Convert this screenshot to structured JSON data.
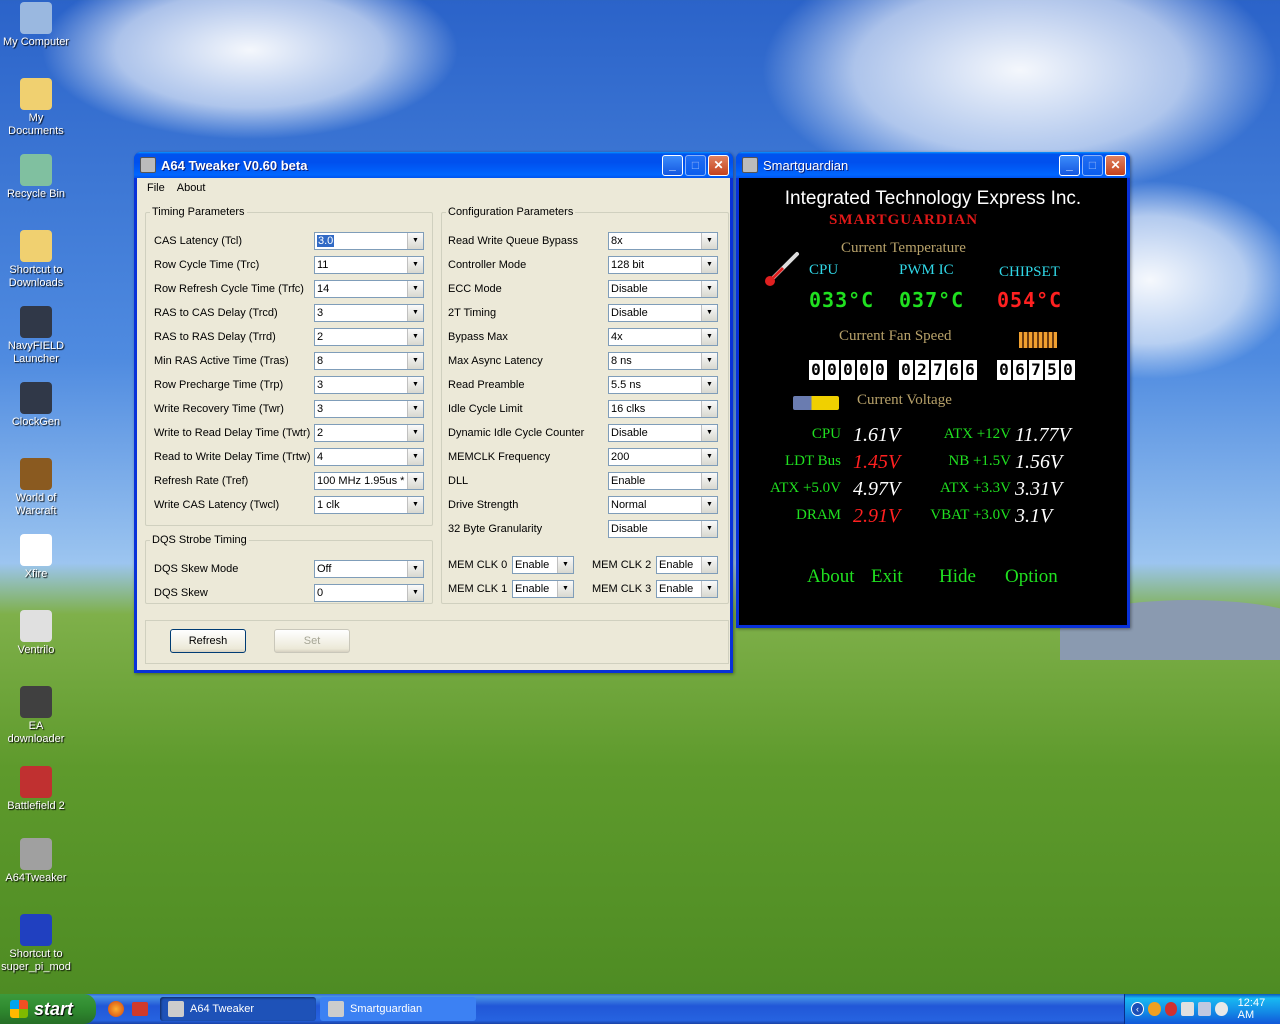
{
  "desktop_icons": [
    {
      "label": "My Computer"
    },
    {
      "label": "My Documents"
    },
    {
      "label": "Recycle Bin"
    },
    {
      "label": "Shortcut to Downloads"
    },
    {
      "label": "NavyFIELD Launcher"
    },
    {
      "label": "ClockGen"
    },
    {
      "label": "World of Warcraft"
    },
    {
      "label": "Xfire"
    },
    {
      "label": "Ventrilo"
    },
    {
      "label": "EA downloader"
    },
    {
      "label": "Battlefield 2"
    },
    {
      "label": "A64Tweaker"
    },
    {
      "label": "Shortcut to super_pi_mod"
    }
  ],
  "a64": {
    "title": "A64 Tweaker V0.60 beta",
    "menu": [
      "File",
      "About"
    ],
    "timing_title": "Timing Parameters",
    "timing": [
      {
        "label": "CAS Latency (Tcl)",
        "value": "3.0"
      },
      {
        "label": "Row Cycle Time (Trc)",
        "value": "11"
      },
      {
        "label": "Row Refresh Cycle Time (Trfc)",
        "value": "14"
      },
      {
        "label": "RAS to CAS Delay (Trcd)",
        "value": "3"
      },
      {
        "label": "RAS to RAS Delay (Trrd)",
        "value": "2"
      },
      {
        "label": "Min RAS Active Time (Tras)",
        "value": "8"
      },
      {
        "label": "Row Precharge Time (Trp)",
        "value": "3"
      },
      {
        "label": "Write Recovery Time (Twr)",
        "value": "3"
      },
      {
        "label": "Write to Read Delay Time (Twtr)",
        "value": "2"
      },
      {
        "label": "Read to Write Delay Time (Trtw)",
        "value": "4"
      },
      {
        "label": "Refresh Rate (Tref)",
        "value": "100 MHz 1.95us *"
      },
      {
        "label": "Write CAS Latency (Twcl)",
        "value": "1 clk"
      }
    ],
    "dqs_title": "DQS Strobe Timing",
    "dqs": [
      {
        "label": "DQS Skew Mode",
        "value": "Off"
      },
      {
        "label": "DQS Skew",
        "value": "0"
      }
    ],
    "config_title": "Configuration Parameters",
    "config": [
      {
        "label": "Read Write Queue Bypass",
        "value": "8x"
      },
      {
        "label": "Controller Mode",
        "value": "128 bit"
      },
      {
        "label": "ECC Mode",
        "value": "Disable"
      },
      {
        "label": "2T Timing",
        "value": "Disable"
      },
      {
        "label": "Bypass Max",
        "value": "4x"
      },
      {
        "label": "Max Async Latency",
        "value": "8 ns"
      },
      {
        "label": "Read Preamble",
        "value": "5.5 ns"
      },
      {
        "label": "Idle Cycle Limit",
        "value": "16 clks"
      },
      {
        "label": "Dynamic Idle Cycle Counter",
        "value": "Disable"
      },
      {
        "label": "MEMCLK Frequency",
        "value": "200"
      },
      {
        "label": "DLL",
        "value": "Enable"
      },
      {
        "label": "Drive Strength",
        "value": "Normal"
      },
      {
        "label": "32 Byte Granularity",
        "value": "Disable"
      }
    ],
    "memclk": [
      {
        "label": "MEM CLK 0",
        "value": "Enable"
      },
      {
        "label": "MEM CLK 2",
        "value": "Enable"
      },
      {
        "label": "MEM CLK 1",
        "value": "Enable"
      },
      {
        "label": "MEM CLK 3",
        "value": "Enable"
      }
    ],
    "refresh_label": "Refresh",
    "set_label": "Set"
  },
  "sg": {
    "title": "Smartguardian",
    "vendor": "Integrated Technology Express Inc.",
    "brand": "SMARTGUARDIAN",
    "temp_title": "Current Temperature",
    "temp_labels": [
      "CPU",
      "PWM IC",
      "CHIPSET"
    ],
    "temp_values": [
      "033°C",
      "037°C",
      "054°C"
    ],
    "fan_title": "Current Fan Speed",
    "fans": [
      "00000",
      "02766",
      "06750"
    ],
    "volt_title": "Current Voltage",
    "volts": [
      {
        "label": "CPU",
        "value": "1.61V"
      },
      {
        "label": "ATX +12V",
        "value": "11.77V"
      },
      {
        "label": "LDT Bus",
        "value": "1.45V"
      },
      {
        "label": "NB +1.5V",
        "value": "1.56V"
      },
      {
        "label": "ATX +5.0V",
        "value": "4.97V"
      },
      {
        "label": "ATX +3.3V",
        "value": "3.31V"
      },
      {
        "label": "DRAM",
        "value": "2.91V"
      },
      {
        "label": "VBAT +3.0V",
        "value": "3.1V"
      }
    ],
    "actions": [
      "About",
      "Exit",
      "Hide",
      "Option"
    ],
    "colors": {
      "label": "#20e020",
      "value": "#ffffff",
      "warn": "#ff2020",
      "title": "#b8a26a",
      "temp_green": "#20e020",
      "temp_red": "#ff2020"
    }
  },
  "taskbar": {
    "start": "start",
    "tasks": [
      "A64 Tweaker",
      "Smartguardian"
    ],
    "clock": "12:47 AM"
  }
}
